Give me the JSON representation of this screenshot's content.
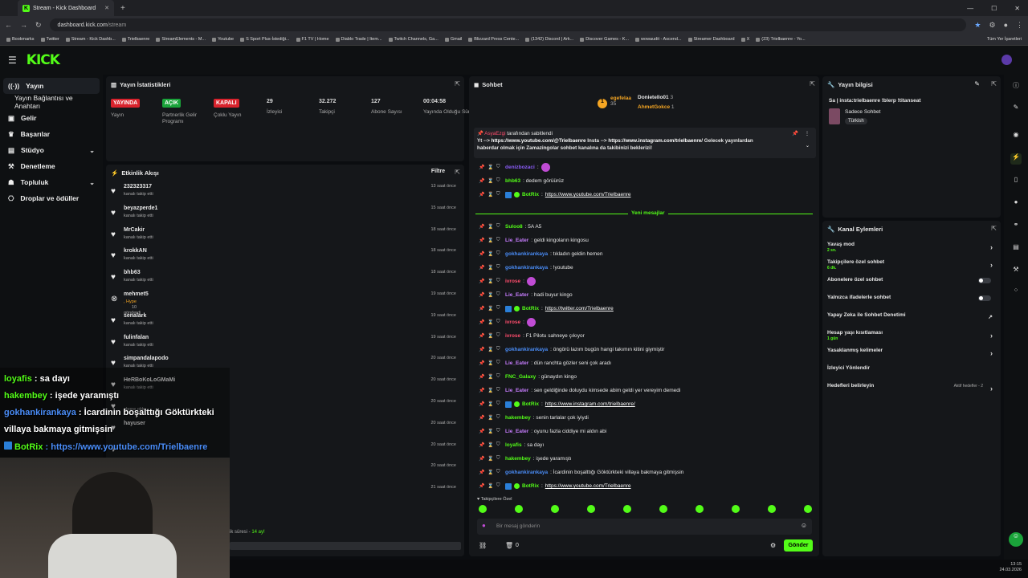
{
  "browser": {
    "tab_title": "Stream - Kick Dashboard",
    "tab_favicon": "K",
    "url_host": "dashboard.kick.com",
    "url_path": "/stream",
    "bookmarks": [
      "Bookmarks",
      "Twitter",
      "Stream - Kick Dashb...",
      "Trielbaenre",
      "StreamElements - M...",
      "Youtube",
      "S Sport Plus-İstediği...",
      "F1 TV | Home",
      "Diablo Trade | Item...",
      "Twitch Channels, Ga...",
      "Gmail",
      "Blizzard Press Cente...",
      "(1342) Discord | Ark...",
      "Discover Games - K...",
      "wowaudit - Ascend...",
      "Streamer Dashboard",
      "X",
      "(23) Trielbaenre - Yo..."
    ],
    "all_bookmarks": "Tüm Yer İşaretleri"
  },
  "header": {
    "logo": "KICK"
  },
  "sidebar": {
    "items": [
      {
        "label": "Yayın",
        "icon": "broadcast-icon"
      },
      {
        "label": "Yayın Bağlantısı ve Anahtarı"
      },
      {
        "label": "Gelir",
        "icon": "wallet-icon"
      },
      {
        "label": "Başarılar",
        "icon": "trophy-icon"
      },
      {
        "label": "Stüdyo",
        "icon": "studio-icon"
      },
      {
        "label": "Denetleme",
        "icon": "hammer-icon"
      },
      {
        "label": "Topluluk",
        "icon": "community-icon"
      },
      {
        "label": "Droplar ve ödüller",
        "icon": "gift-icon"
      }
    ]
  },
  "stats": {
    "title": "Yayın İstatistikleri",
    "items": [
      {
        "value": "YAYINDA",
        "label": "Yayın",
        "badge": "red"
      },
      {
        "value": "AÇIK",
        "label": "Partnerlik Gelir Programı",
        "badge": "green"
      },
      {
        "value": "KAPALI",
        "label": "Çoklu Yayın",
        "badge": "red"
      },
      {
        "value": "29",
        "label": "İzleyici"
      },
      {
        "value": "32.272",
        "label": "Takipçi"
      },
      {
        "value": "127",
        "label": "Abone Sayısı"
      },
      {
        "value": "00:04:58",
        "label": "Yayında Olduğu Süre"
      }
    ]
  },
  "activity": {
    "title": "Etkinlik Akışı",
    "filter": "Filtre",
    "items": [
      {
        "name": "232323317",
        "sub": "kanalı takip etti",
        "time": "13 saat önce"
      },
      {
        "name": "beyazperde1",
        "sub": "kanalı takip etti",
        "time": "15 saat önce"
      },
      {
        "name": "MrCakir",
        "sub": "kanalı takip etti",
        "time": "18 saat önce"
      },
      {
        "name": "krokkAN",
        "sub": "kanalı takip etti",
        "time": "18 saat önce"
      },
      {
        "name": "bhb63",
        "sub": "kanalı takip etti",
        "time": "18 saat önce"
      },
      {
        "name": "mehmet5",
        "sub": ", Hype",
        "sub2": "10",
        "sub3": "gönderdi",
        "time": "19 saat önce"
      },
      {
        "name": "senalark",
        "sub": "kanalı takip etti",
        "time": "19 saat önce"
      },
      {
        "name": "fulinfalan",
        "sub": "kanalı takip etti",
        "time": "19 saat önce"
      },
      {
        "name": "simpandalapodo",
        "sub": "kanalı takip etti",
        "time": "20 saat önce"
      },
      {
        "name": "HeRBoKoLoGMaMi",
        "sub": "kanalı takip etti",
        "time": "20 saat önce"
      },
      {
        "name": "",
        "sub": "abone oldu",
        "time": "20 saat önce"
      },
      {
        "name": "hayuser",
        "sub": "",
        "time": "20 saat önce"
      },
      {
        "name": "",
        "sub": "",
        "time": "20 saat önce"
      },
      {
        "name": "",
        "sub": "",
        "time": "20 saat önce"
      },
      {
        "name": "",
        "sub": "",
        "time": "21 saat önce"
      }
    ],
    "footer_pre": "ik süresi - ",
    "footer_val": "14 ay!"
  },
  "chat": {
    "title": "Sohbet",
    "top_users": [
      {
        "name": "egefelaa",
        "count": "35"
      },
      {
        "name": "Donietello01",
        "count": "3"
      },
      {
        "name": "AhmetGokce",
        "count": "1"
      }
    ],
    "pinned_by_user": "AsyaEzgi",
    "pinned_by_text": "tarafından sabitlendi",
    "pinned_text_1": "Yt --> ",
    "pinned_link_1": "https://www.youtube.com/@Trielbaenre",
    "pinned_text_2": " Insta --> ",
    "pinned_link_2": "https://www.instagram.com/trielbaenre/",
    "pinned_text_3": " Gelecek yayınlardan",
    "pinned_line2": "haberdar olmak için Zamazingolar sohbet kanalına da takibinizi beklerizi!",
    "pre_messages": [
      {
        "user": "denizbozaci",
        "text": ":",
        "color": "#8a5cf6"
      },
      {
        "user": "bhb63",
        "text": ": dedem görüürüz",
        "color": "#53fc18"
      },
      {
        "user": "BotRix",
        "text": ": ",
        "link": "https://www.youtube.com/Trielbaenre",
        "color": "#53fc18"
      }
    ],
    "new_messages_label": "Yeni mesajlar",
    "messages": [
      {
        "user": "Suloo8",
        "text": ": 5A A5",
        "color": "#53fc18"
      },
      {
        "user": "Lie_Eater",
        "text": ": geldi kingoların kingosu",
        "color": "#c77dff"
      },
      {
        "user": "gokhankirankaya",
        "text": ": tıkladın geldin hemen",
        "color": "#4a8df8"
      },
      {
        "user": "gokhankirankaya",
        "text": ": !youtube",
        "color": "#4a8df8"
      },
      {
        "user": "ivrose",
        "text": ":",
        "color": "#ff4d6d"
      },
      {
        "user": "Lie_Eater",
        "text": ": hadi buyur kingo",
        "color": "#c77dff"
      },
      {
        "user": "BotRix",
        "text": ": ",
        "link": "https://twitter.com/Trielbaenre",
        "color": "#53fc18"
      },
      {
        "user": "ivrose",
        "text": ":",
        "color": "#ff4d6d"
      },
      {
        "user": "ivrose",
        "text": ": F1 Pilotu sahneye çıkıyor",
        "color": "#ff4d6d"
      },
      {
        "user": "gokhankirankaya",
        "text": ": öngörü lazım bugün hangi takımın kitini giymiştir",
        "color": "#4a8df8"
      },
      {
        "user": "Lie_Eater",
        "text": ": dün ranchta gözler seni çok aradı",
        "color": "#c77dff"
      },
      {
        "user": "FNC_Galaxy",
        "text": ": günaydın kingo",
        "color": "#53fc18"
      },
      {
        "user": "Lie_Eater",
        "text": ": sen geldiğinde doluydu kimsede abim geldi yer vereyim demedi",
        "color": "#c77dff"
      },
      {
        "user": "BotRix",
        "text": ": ",
        "link": "https://www.instagram.com/trielbaenre/",
        "color": "#53fc18"
      },
      {
        "user": "hakembey",
        "text": ": senin tarlalar çok iyiydi",
        "color": "#53fc18"
      },
      {
        "user": "Lie_Eater",
        "text": ": oyunu fazla ciddiye mi aldın abi",
        "color": "#c77dff"
      },
      {
        "user": "loyafis",
        "text": ": sa dayı",
        "color": "#53fc18"
      },
      {
        "user": "hakembey",
        "text": ": işede yaramıştı",
        "color": "#53fc18"
      },
      {
        "user": "gokhankirankaya",
        "text": ": İcardinin boşalttığı Göktürkteki villaya bakmaya gitmişsin",
        "color": "#4a8df8"
      },
      {
        "user": "BotRix",
        "text": ": ",
        "link": "https://www.youtube.com/Trielbaenre",
        "color": "#53fc18"
      }
    ],
    "followers_only": "Takipçilere Özel",
    "input_placeholder": "Bir mesaj gönderin",
    "count": "0",
    "send": "Gönder"
  },
  "stream_info": {
    "title": "Yayın bilgisi",
    "stream_title": "Sa | insta:trielbaenre !blerp !titanseat",
    "category": "Sadece Sohbet",
    "tag": "Türkish"
  },
  "channel_actions": {
    "title": "Kanal Eylemleri",
    "rows": [
      {
        "label": "Yavaş mod",
        "sub": "2 sn.",
        "type": "chev"
      },
      {
        "label": "Takipçilere özel sohbet",
        "sub": "6 dk.",
        "type": "chev"
      },
      {
        "label": "Abonelere özel sohbet",
        "type": "toggle"
      },
      {
        "label": "Yalnızca ifadelerle sohbet",
        "type": "toggle"
      },
      {
        "label": "Yapay Zeka ile Sohbet Denetimi",
        "type": "ext"
      },
      {
        "label": "Hesap yaşı kısıtlaması",
        "sub": "1 gün",
        "type": "chev"
      },
      {
        "label": "Yasaklanmış kelimeler",
        "type": "chev"
      },
      {
        "label": "İzleyici Yönlendir",
        "type": "none"
      },
      {
        "label": "Hedefleri belirleyin",
        "extra": "Aktif hedefler - 2",
        "type": "chev"
      }
    ]
  },
  "overlay": {
    "lines": [
      {
        "user": "loyafis",
        "text": " : sa dayı",
        "color": "#53fc18"
      },
      {
        "user": "hakembey",
        "text": " : işede yaramıştı",
        "color": "#53fc18"
      },
      {
        "user": "gokhankirankaya",
        "text": " : İcardinin boşalttığı Göktürkteki",
        "color": "#4a8df8"
      },
      {
        "user": "",
        "text": "villaya bakmaya gitmişsin",
        "color": "#fff"
      },
      {
        "user": "BotRix",
        "text": " : https://www.youtube.com/Trielbaenre",
        "color": "#53fc18"
      }
    ]
  },
  "taskbar": {
    "time": "13:15",
    "date": "24.03.2026"
  }
}
